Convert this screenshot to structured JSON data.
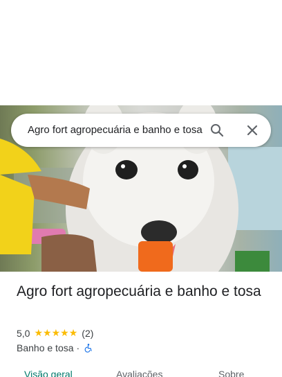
{
  "search": {
    "query": "Agro fort agropecuária e banho e tosa"
  },
  "place": {
    "name": "Agro fort agropecuária e banho e tosa",
    "rating": "5,0",
    "stars": [
      "★",
      "★",
      "★",
      "★",
      "★"
    ],
    "review_count": "(2)",
    "category": "Banho e tosa",
    "separator": "·"
  },
  "tabs": [
    {
      "label": "Visão geral"
    },
    {
      "label": "Avaliações"
    },
    {
      "label": "Sobre"
    }
  ],
  "colors": {
    "accent": "#00796b",
    "star": "#fbbc04",
    "accessibility": "#1a73e8"
  }
}
